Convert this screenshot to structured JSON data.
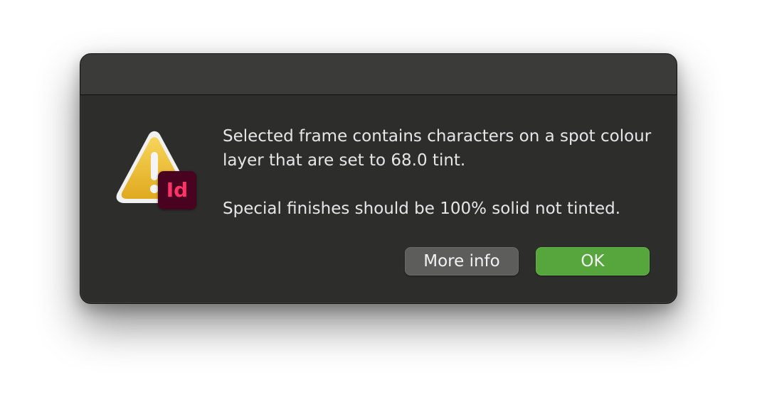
{
  "dialog": {
    "message_line_1": "Selected frame contains characters on a spot colour layer that are set to 68.0 tint.",
    "message_line_2": "Special finishes should be 100% solid not tinted.",
    "app_badge_label": "Id",
    "warning_icon": "warning-triangle-icon",
    "app_icon": "indesign-app-icon",
    "buttons": {
      "more_info_label": "More info",
      "ok_label": "OK"
    }
  },
  "colors": {
    "dialog_background": "#2d2e2c",
    "titlebar_background": "#3b3c3a",
    "ok_button": "#56a63d",
    "more_info_button": "#5d5e5c",
    "badge_background": "#49021f",
    "badge_text": "#ff3366",
    "warning_yellow": "#f2c12e"
  }
}
